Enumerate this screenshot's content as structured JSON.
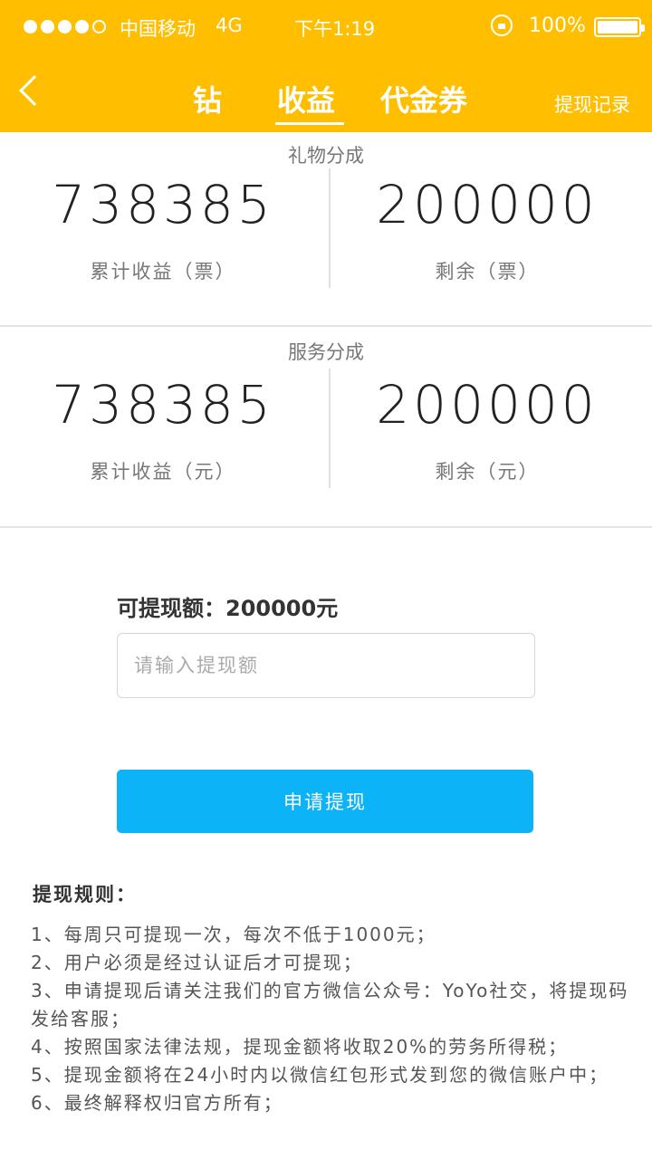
{
  "status_bar": {
    "carrier": "中国移动",
    "network": "4G",
    "time": "下午1:19",
    "battery_percent": "100%",
    "signal_bars_filled": 4,
    "signal_bars_total": 5,
    "icons": [
      "signal-dots-icon",
      "rotation-lock-icon",
      "battery-icon"
    ]
  },
  "navbar": {
    "back_icon": "back-chevron-icon",
    "tabs": [
      {
        "label": "钻",
        "active": false
      },
      {
        "label": "收益",
        "active": true
      },
      {
        "label": "代金券",
        "active": false
      }
    ],
    "right_link": "提现记录",
    "background_color": "#FFBF00"
  },
  "gift_section": {
    "title": "礼物分成",
    "total": {
      "value": "738385",
      "label": "累计收益（票）"
    },
    "remaining": {
      "value": "200000",
      "label": "剩余（票）"
    }
  },
  "service_section": {
    "title": "服务分成",
    "total": {
      "value": "738385",
      "label": "累计收益（元）"
    },
    "remaining": {
      "value": "200000",
      "label": "剩余（元）"
    }
  },
  "withdraw": {
    "available_text": "可提现额：200000元",
    "input_placeholder": "请输入提现额",
    "input_value": "",
    "button_label": "申请提现",
    "button_color": "#0DB3F7"
  },
  "rules": {
    "title": "提现规则：",
    "items": [
      "1、每周只可提现一次，每次不低于1000元；",
      "2、用户必须是经过认证后才可提现；",
      "3、申请提现后请关注我们的官方微信公众号：YoYo社交，将提现码发给客服；",
      "4、按照国家法律法规，提现金额将收取20%的劳务所得税；",
      "5、提现金额将在24小时内以微信红包形式发到您的微信账户中；",
      "6、最终解释权归官方所有；"
    ]
  }
}
